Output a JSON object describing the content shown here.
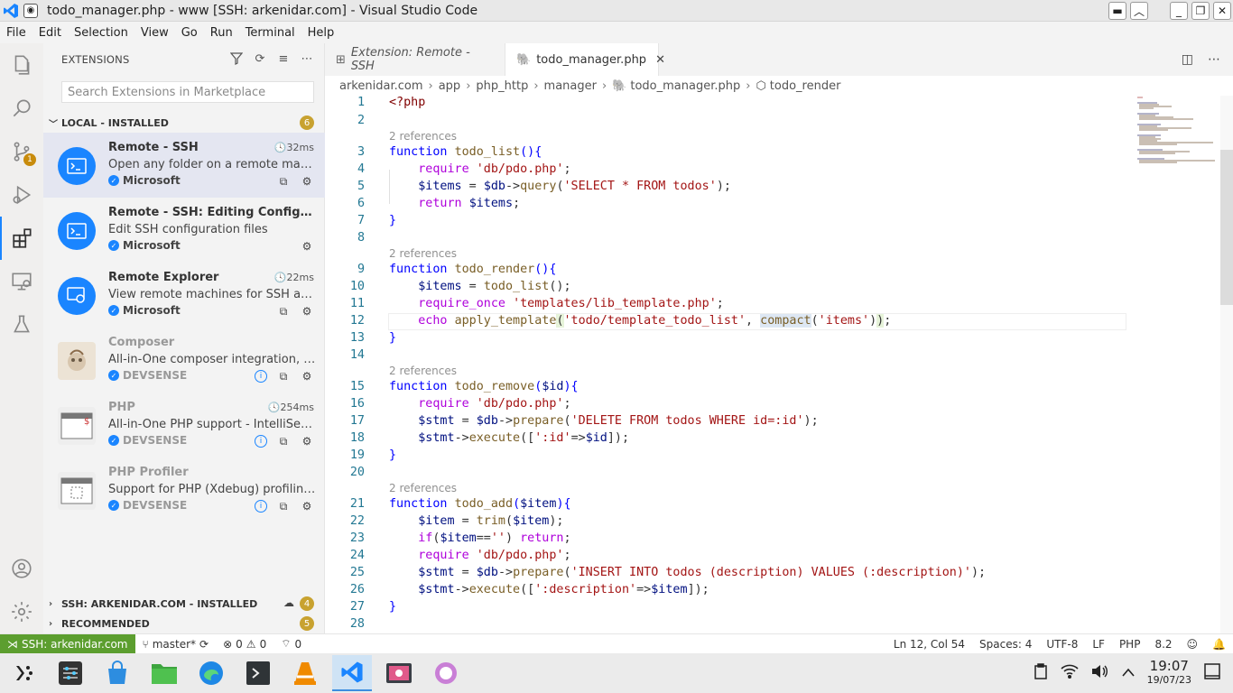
{
  "window": {
    "title": "todo_manager.php - www [SSH: arkenidar.com] - Visual Studio Code"
  },
  "menu": [
    "File",
    "Edit",
    "Selection",
    "View",
    "Go",
    "Run",
    "Terminal",
    "Help"
  ],
  "activity": {
    "scm_badge": "1"
  },
  "sidebar": {
    "title": "EXTENSIONS",
    "search_placeholder": "Search Extensions in Marketplace",
    "local_section": {
      "label": "LOCAL - INSTALLED",
      "count": "6"
    },
    "ssh_section": {
      "label": "SSH: ARKENIDAR.COM - INSTALLED",
      "count": "4"
    },
    "recommended_section": {
      "label": "RECOMMENDED",
      "count": "5"
    },
    "extensions": [
      {
        "name": "Remote - SSH",
        "time": "32ms",
        "desc": "Open any folder on a remote machi...",
        "publisher": "Microsoft"
      },
      {
        "name": "Remote - SSH: Editing Configurati...",
        "time": "",
        "desc": "Edit SSH configuration files",
        "publisher": "Microsoft"
      },
      {
        "name": "Remote Explorer",
        "time": "22ms",
        "desc": "View remote machines for SSH and ...",
        "publisher": "Microsoft"
      },
      {
        "name": "Composer",
        "time": "",
        "desc": "All-in-One composer integration, q...",
        "publisher": "DEVSENSE"
      },
      {
        "name": "PHP",
        "time": "254ms",
        "desc": "All-in-One PHP support - IntelliSens...",
        "publisher": "DEVSENSE"
      },
      {
        "name": "PHP Profiler",
        "time": "",
        "desc": "Support for PHP (Xdebug) profiling ...",
        "publisher": "DEVSENSE"
      }
    ]
  },
  "tabs": [
    {
      "label": "Extension: Remote - SSH"
    },
    {
      "label": "todo_manager.php"
    }
  ],
  "breadcrumb": [
    "arkenidar.com",
    "app",
    "php_http",
    "manager",
    "todo_manager.php",
    "todo_render"
  ],
  "editor": {
    "lens": "2 references",
    "line_numbers": [
      "1",
      "2",
      "3",
      "4",
      "5",
      "6",
      "7",
      "8",
      "9",
      "10",
      "11",
      "12",
      "13",
      "14",
      "15",
      "16",
      "17",
      "18",
      "19",
      "20",
      "21",
      "22",
      "23",
      "24",
      "25",
      "26",
      "27",
      "28"
    ]
  },
  "status": {
    "remote": "SSH: arkenidar.com",
    "branch": "master*",
    "errors": "0",
    "warnings": "0",
    "ports": "0",
    "position": "Ln 12, Col 54",
    "spaces": "Spaces: 4",
    "encoding": "UTF-8",
    "eol": "LF",
    "language": "PHP",
    "version": "8.2"
  },
  "taskbar": {
    "time": "19:07",
    "date": "19/07/23"
  },
  "colors": {
    "accent": "#1a85ff",
    "remote_status": "#5c9e2f",
    "badge": "#c8a230"
  }
}
